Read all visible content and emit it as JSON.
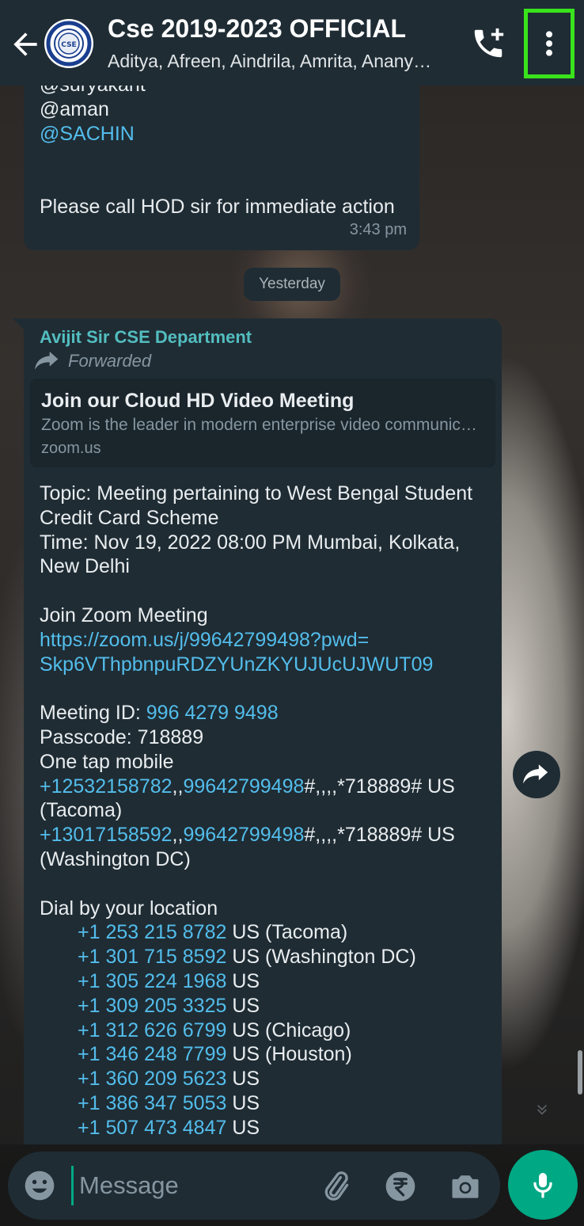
{
  "header": {
    "title": "Cse 2019-2023 OFFICIAL",
    "subtitle": "Aditya, Afreen, Aindrila, Amrita, Anany…",
    "avatar_text": "CSE"
  },
  "messages": {
    "first": {
      "lines": [
        "@suryakant",
        "@aman",
        "@SACHIN",
        "",
        "Please call HOD sir for immediate action"
      ],
      "mention_lines": [
        false,
        false,
        true,
        false,
        false
      ],
      "time": "3:43 pm"
    },
    "date_divider": "Yesterday",
    "second": {
      "sender": "Avijit Sir CSE Department",
      "forwarded_label": "Forwarded",
      "preview": {
        "title": "Join our Cloud HD Video Meeting",
        "description": "Zoom is the leader in modern enterprise video communications",
        "domain": "zoom.us"
      },
      "topic": [
        "Topic: Meeting pertaining to West Bengal Student",
        "Credit Card Scheme"
      ],
      "time": [
        "Time: Nov 19, 2022 08:00 PM Mumbai, Kolkata,",
        "New Delhi"
      ],
      "join_label": "Join Zoom Meeting",
      "join_url": [
        "https://zoom.us/j/99642799498?pwd=",
        "Skp6VThpbnpuRDZYUnZKYUJUcUJWUT09"
      ],
      "meeting_id_label": "Meeting ID: ",
      "meeting_id": "996 4279 9498",
      "passcode": "Passcode: 718889",
      "one_tap_label": "One tap mobile",
      "one_tap": [
        {
          "num1": "+12532158782",
          "sep": ",,",
          "num2": "99642799498",
          "rest": "#,,,,*718889# US",
          "loc": "(Tacoma)"
        },
        {
          "num1": "+13017158592",
          "sep": ",,",
          "num2": "99642799498",
          "rest": "#,,,,*718889# US",
          "loc": "(Washington DC)"
        }
      ],
      "dial_label": "Dial by your location",
      "dial": [
        {
          "num": "+1 253 215 8782",
          "loc": " US (Tacoma)"
        },
        {
          "num": "+1 301 715 8592",
          "loc": " US (Washington DC)"
        },
        {
          "num": "+1 305 224 1968",
          "loc": " US"
        },
        {
          "num": "+1 309 205 3325",
          "loc": " US"
        },
        {
          "num": "+1 312 626 6799",
          "loc": " US (Chicago)"
        },
        {
          "num": "+1 346 248 7799",
          "loc": " US (Houston)"
        },
        {
          "num": "+1 360 209 5623",
          "loc": " US"
        },
        {
          "num": "+1 386 347 5053",
          "loc": " US"
        },
        {
          "num": "+1 507 473 4847",
          "loc": " US"
        }
      ]
    }
  },
  "composer": {
    "placeholder": "Message"
  },
  "colors": {
    "accent": "#00a884",
    "link": "#53bdeb",
    "bubble": "#1f2c34",
    "header": "#1f2c34",
    "highlight": "#39e31c"
  },
  "icons": [
    "back-arrow-icon",
    "group-avatar-icon",
    "add-call-icon",
    "more-vert-icon",
    "forward-icon",
    "chevron-down-icon",
    "emoji-icon",
    "attach-icon",
    "rupee-icon",
    "camera-icon",
    "mic-icon"
  ]
}
